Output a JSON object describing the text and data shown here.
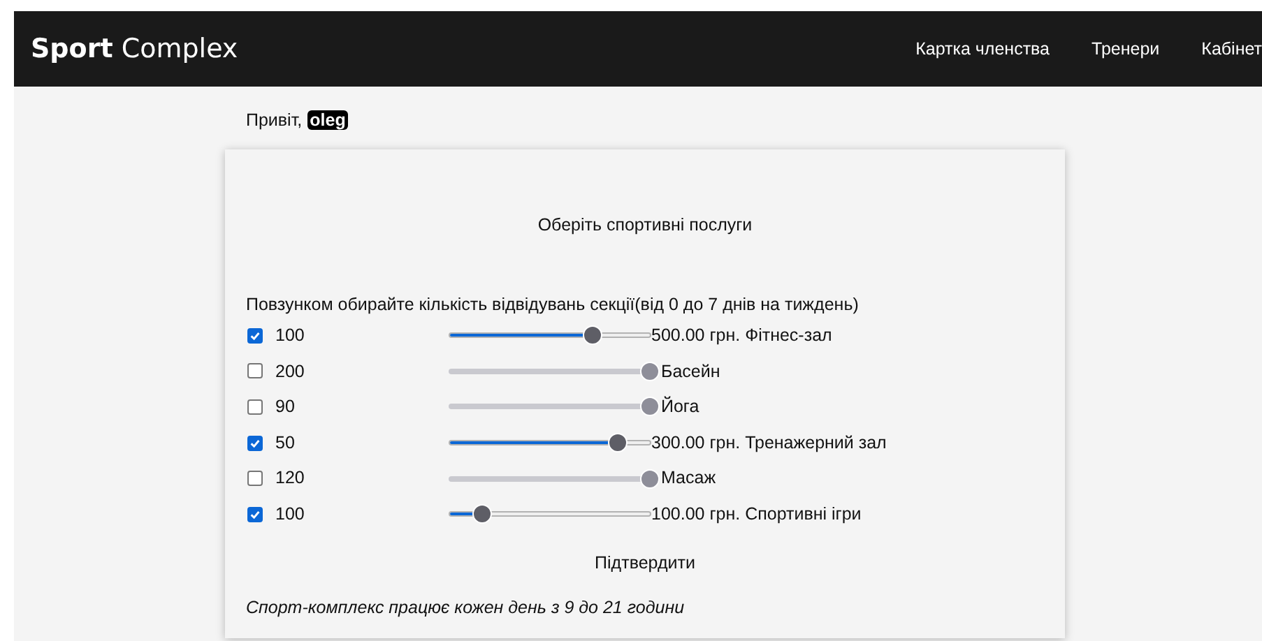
{
  "navbar": {
    "brand": "**Sport** Complex",
    "links": [
      "Картка членства",
      "Тренери",
      "Кабінет"
    ]
  },
  "greeting": {
    "text": "Привіт,",
    "user": "oleg"
  },
  "form": {
    "title": "Оберіть спортивні послуги",
    "hint": "Повзунком обирайте кількість відвідувань секції(від 0 до 7 днів на тиждень)",
    "services": [
      {
        "checked": true,
        "price": "100",
        "level": 0.71,
        "label": "500.00 грн. Фітнес-зал"
      },
      {
        "checked": false,
        "price": "200",
        "level": 1,
        "label": "Басейн"
      },
      {
        "checked": false,
        "price": "90",
        "level": 1,
        "label": "Йога"
      },
      {
        "checked": true,
        "price": "50",
        "level": 0.84,
        "label": "300.00 грн. Тренажерний зал"
      },
      {
        "checked": false,
        "price": "120",
        "level": 1,
        "label": "Масаж"
      },
      {
        "checked": true,
        "price": "100",
        "level": 0.16,
        "label": "100.00 грн. Спортивні ігри"
      }
    ],
    "submit": "Підтвердити",
    "note": "Спорт-комплекс працює кожен день з 9 до 21 години"
  }
}
